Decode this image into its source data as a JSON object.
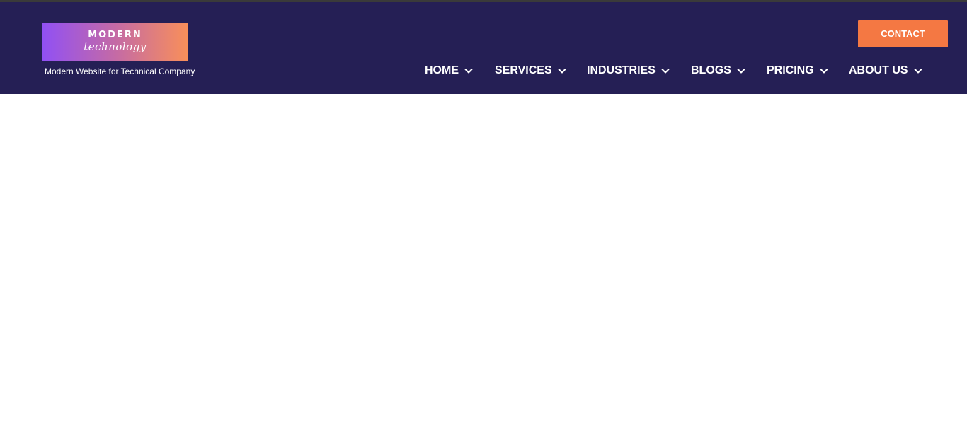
{
  "header": {
    "logo": {
      "line1": "MODERN",
      "line2": "technology"
    },
    "tagline": "Modern Website for Technical Company",
    "contact_label": "CONTACT",
    "colors": {
      "header_bg": "#251f55",
      "button_bg": "#f47843",
      "logo_gradient_start": "#9150f4",
      "logo_gradient_end": "#f88f5a"
    }
  },
  "nav": {
    "items": [
      {
        "label": "HOME",
        "icon": "chevron-down-icon"
      },
      {
        "label": "SERVICES",
        "icon": "chevron-down-icon"
      },
      {
        "label": "INDUSTRIES",
        "icon": "chevron-down-icon"
      },
      {
        "label": "BLOGS",
        "icon": "chevron-down-icon"
      },
      {
        "label": "PRICING",
        "icon": "chevron-down-icon"
      },
      {
        "label": "ABOUT US",
        "icon": "chevron-down-icon"
      }
    ]
  }
}
